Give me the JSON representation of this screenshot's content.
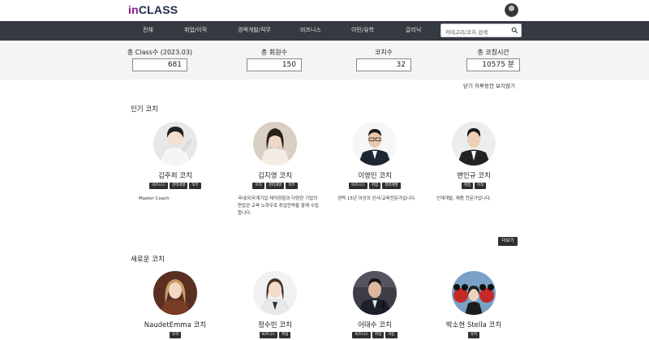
{
  "header": {
    "logo_in": "in",
    "logo_class": "CLASS"
  },
  "nav": {
    "items": [
      "전체",
      "취업/이직",
      "경력개발/직무",
      "비즈니스",
      "이민/유학",
      "글리닉"
    ],
    "search_placeholder": "카테고리/코치 검색"
  },
  "stats": [
    {
      "label": "총 Class수 (2023.03)",
      "value": "681"
    },
    {
      "label": "총 회원수",
      "value": "150"
    },
    {
      "label": "코치수",
      "value": "32"
    },
    {
      "label": "총 코칭시간",
      "value": "10575 분"
    }
  ],
  "hide_today": "닫기 하루동안 보지않기",
  "popular": {
    "title": "인기 코치",
    "coaches": [
      {
        "name": "김주희 코치",
        "tags": [
          "비즈니스",
          "경력개발",
          "직무"
        ],
        "desc": "Master Coach"
      },
      {
        "name": "김지영 코치",
        "tags": [
          "이직",
          "경력개발",
          "직무"
        ],
        "desc": "국내/외국계기업 채직경험과 다양한 기업의 면접관 교육 노하우로 취업전략을 함께 수립합니다."
      },
      {
        "name": "이영민 코치",
        "tags": [
          "비즈니스",
          "취업",
          "경력개발"
        ],
        "desc": "경력 15년 이상의 인사/교육전문가입니다."
      },
      {
        "name": "변인규 코치",
        "tags": [
          "취업",
          "이직"
        ],
        "desc": "인재개발, 채용 전문가입니다."
      }
    ]
  },
  "more_label": "더보기",
  "new": {
    "title": "새로운 코치",
    "coaches": [
      {
        "name": "NaudetEmma 코치",
        "tags": [
          "유학"
        ]
      },
      {
        "name": "정수빈 코치",
        "tags": [
          "비즈니스",
          "취업"
        ]
      },
      {
        "name": "어태수 코치",
        "tags": [
          "비즈니스",
          "취업",
          "이민"
        ]
      },
      {
        "name": "박소현 Stella 코치",
        "tags": [
          "유학"
        ]
      }
    ]
  },
  "colors": {
    "nav_bg": "#343a40",
    "stats_bg": "#f4f4f5",
    "logo_in": "#8a1c8c",
    "logo_class": "#1d2b4a",
    "tag_bg": "#2f2f2f"
  }
}
